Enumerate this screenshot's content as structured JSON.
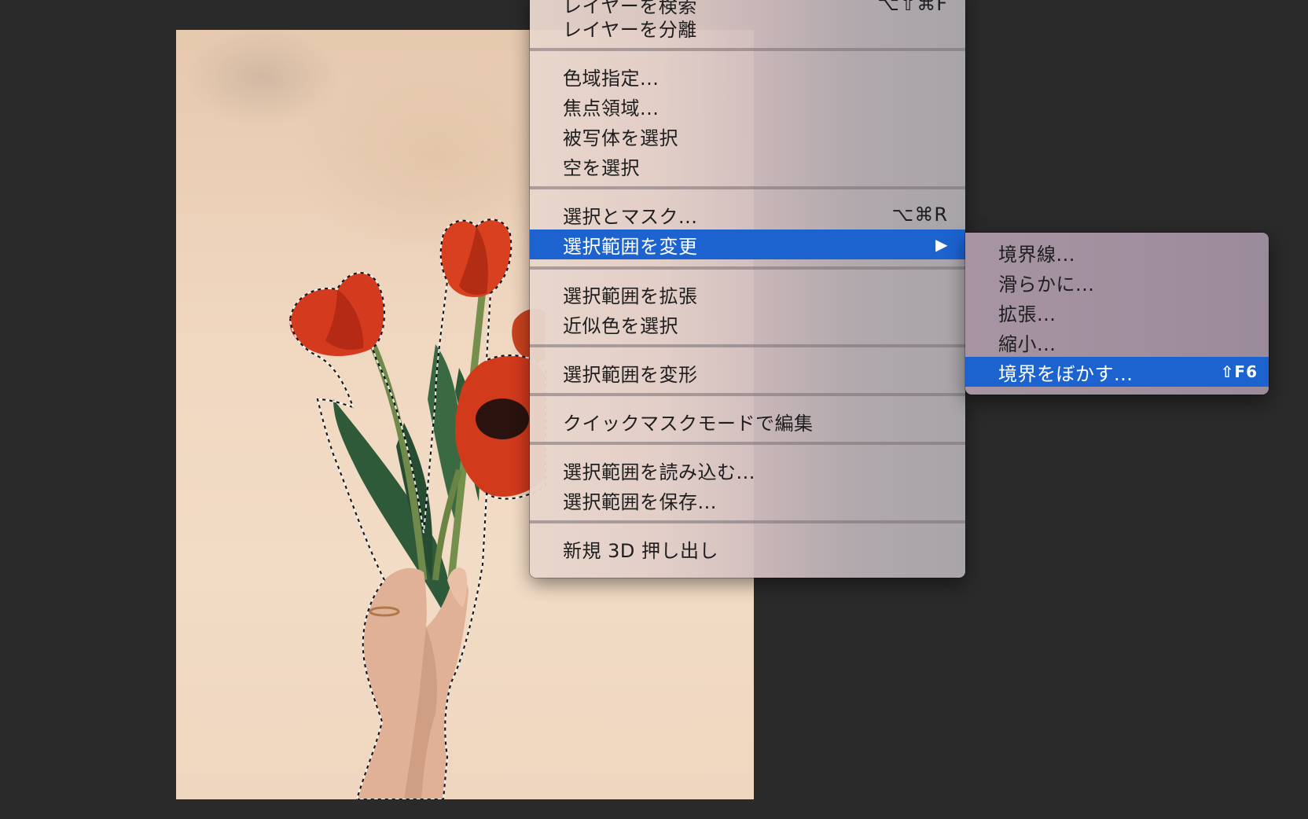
{
  "main_menu": {
    "items": [
      {
        "label": "レイヤーを検索",
        "shortcut": "⌥⇧⌘F"
      },
      {
        "label": "レイヤーを分離",
        "shortcut": ""
      },
      {
        "label": "色域指定...",
        "shortcut": ""
      },
      {
        "label": "焦点領域...",
        "shortcut": ""
      },
      {
        "label": "被写体を選択",
        "shortcut": ""
      },
      {
        "label": "空を選択",
        "shortcut": ""
      },
      {
        "label": "選択とマスク...",
        "shortcut": "⌥⌘R"
      },
      {
        "label": "選択範囲を変更",
        "shortcut": "",
        "submenu_arrow": "▶"
      },
      {
        "label": "選択範囲を拡張",
        "shortcut": ""
      },
      {
        "label": "近似色を選択",
        "shortcut": ""
      },
      {
        "label": "選択範囲を変形",
        "shortcut": ""
      },
      {
        "label": "クイックマスクモードで編集",
        "shortcut": ""
      },
      {
        "label": "選択範囲を読み込む...",
        "shortcut": ""
      },
      {
        "label": "選択範囲を保存...",
        "shortcut": ""
      },
      {
        "label": "新規 3D 押し出し",
        "shortcut": ""
      }
    ],
    "highlighted_item": "選択範囲を変更"
  },
  "sub_menu": {
    "items": [
      {
        "label": "境界線...",
        "shortcut": ""
      },
      {
        "label": "滑らかに...",
        "shortcut": ""
      },
      {
        "label": "拡張...",
        "shortcut": ""
      },
      {
        "label": "縮小...",
        "shortcut": ""
      },
      {
        "label": "境界をぼかす...",
        "shortcut": "⇧F6"
      }
    ],
    "highlighted_item": "境界をぼかす..."
  },
  "colors": {
    "workspace_bg": "#2a2a2a",
    "highlight": "#1c63cf",
    "text": "#1e1e1e",
    "highlight_text": "#ffffff"
  }
}
